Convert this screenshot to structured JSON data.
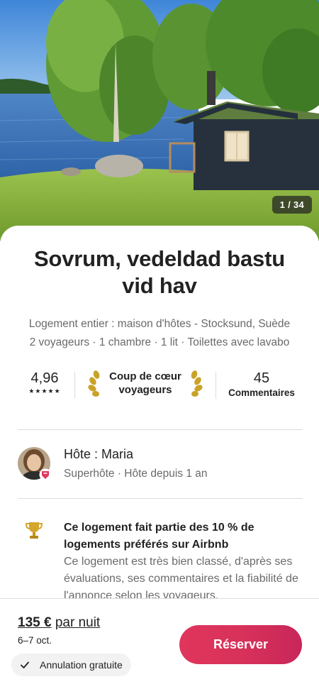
{
  "photo": {
    "counter": "1 / 34",
    "image_icon": "cabin-lake-photo"
  },
  "listing": {
    "title": "Sovrum, vedeldad bastu vid hav",
    "type_location": "Logement entier : maison d'hôtes - Stocksund, Suède",
    "capacity": "2 voyageurs · 1 chambre · 1 lit · Toilettes avec lavabo"
  },
  "stats": {
    "rating": "4,96",
    "stars": "★★★★★",
    "favorite_line1": "Coup de cœur",
    "favorite_line2": "voyageurs",
    "reviews_count": "45",
    "reviews_label": "Commentaires"
  },
  "host": {
    "name_label": "Hôte : Maria",
    "subtitle": "Superhôte · Hôte depuis 1 an"
  },
  "highlight": {
    "icon": "trophy-icon",
    "title": "Ce logement fait partie des 10 % de logements préférés sur Airbnb",
    "body": "Ce logement est très bien classé, d'après ses évaluations, ses commentaires et la fiabilité de l'annonce selon les voyageurs."
  },
  "footer": {
    "price": "135 €",
    "price_unit": "par nuit",
    "dates": "6–7 oct.",
    "cancellation": "Annulation gratuite",
    "reserve_label": "Réserver"
  },
  "colors": {
    "brand": "#e0355c",
    "text_primary": "#222222",
    "text_secondary": "#6a6a6a",
    "divider": "#dddddd"
  }
}
